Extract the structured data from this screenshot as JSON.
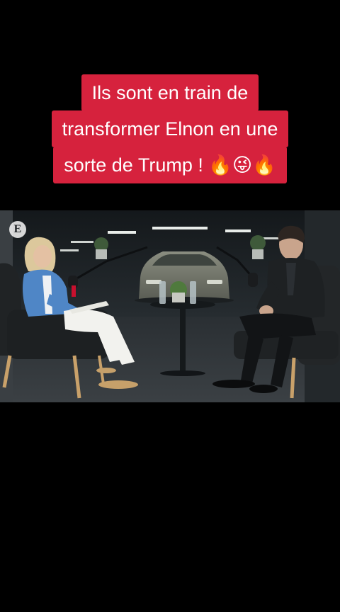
{
  "caption": {
    "lines": [
      "Ils sont en train de",
      "transformer Elnon en une",
      "sorte de Trump ! 🔥😜🔥"
    ]
  },
  "video": {
    "watermark": "E"
  }
}
